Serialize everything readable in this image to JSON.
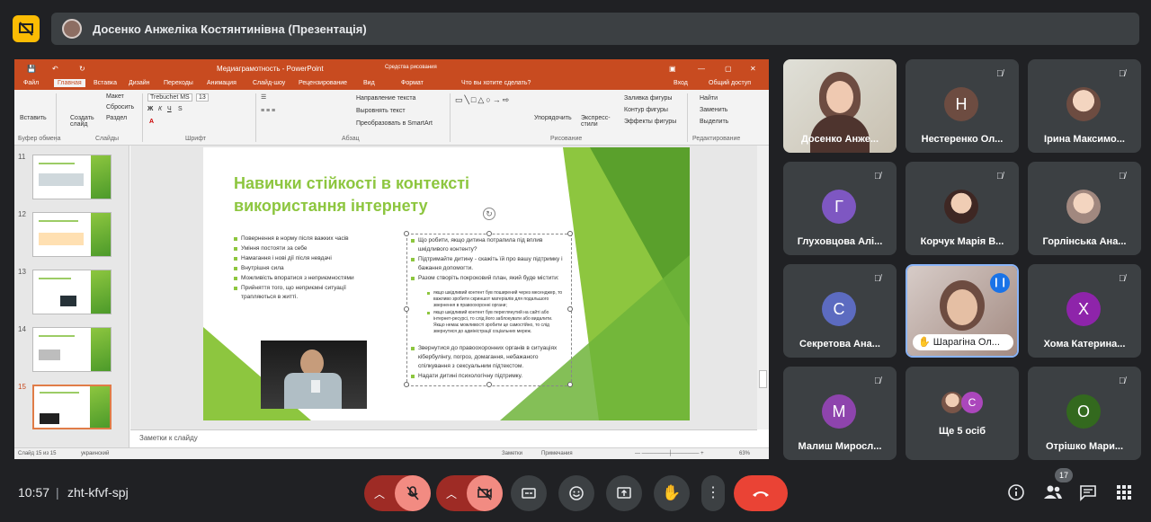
{
  "presenter": {
    "name": "Досенко Анжеліка Костянтинівна (Презентація)"
  },
  "ppt": {
    "file_title": "Медиаграмотность - PowerPoint",
    "tools": "Средства рисования",
    "tabs": [
      "Файл",
      "Главная",
      "Вставка",
      "Дизайн",
      "Переходы",
      "Анимация",
      "Слайд-шоу",
      "Рецензирование",
      "Вид",
      "Формат"
    ],
    "tell_me": "Что вы хотите сделать?",
    "signin": "Вход",
    "share": "Общий доступ",
    "ribbon": {
      "paste": "Вставить",
      "create_slide": "Создать слайд",
      "layout": "Макет",
      "reset": "Сбросить",
      "section": "Раздел",
      "font_name": "Trebuchet MS",
      "font_size": "13",
      "text_dir": "Направление текста",
      "align_text": "Выровнять текст",
      "smartart": "Преобразовать в SmartArt",
      "arrange": "Упорядочить",
      "quick_styles": "Экспресс-стили",
      "fill": "Заливка фигуры",
      "outline": "Контур фигуры",
      "effects": "Эффекты фигуры",
      "find": "Найти",
      "replace": "Заменить",
      "select": "Выделить",
      "groups": [
        "Буфер обмена",
        "Слайды",
        "Шрифт",
        "Абзац",
        "Рисование",
        "Редактирование"
      ]
    },
    "thumb_numbers": [
      "11",
      "12",
      "13",
      "14",
      "15"
    ],
    "slide": {
      "title": "Навички стійкості в контексті використання інтернету",
      "left_bullets": [
        "Повернення в норму після важких часів",
        "Уміння постояти за себе",
        "Намагання і нові дії після невдачі",
        "Внутрішня сила",
        "Можливість впоратися з неприємностями",
        "Прийняття того, що неприємні ситуації трапляються в житті."
      ],
      "right_bullets": [
        "Що робити, якщо дитина потрапила під вплив шкідливого контенту?",
        "Підтримайте дитину - скажіть їй про вашу підтримку і бажання допомогти.",
        "Разом створіть покроковий план, який буде містити:"
      ],
      "right_sub": [
        "якщо шкідливий контент був поширений через месенджер, то важливо зробити скриншот матеріалів для подальшого звернення в правоохоронні органи;",
        "якщо шкідливий контент був переглянутий на сайті або інтернет-ресурсі, то слід його заблокувати або видалити. Якщо немає можливості зробити це самостійно, то слід звернутися до адміністрації соціальних мереж."
      ],
      "right_bullets2": [
        "Звернутися до правоохоронних органів в ситуаціях кібербулінгу, погроз, домагання, небажаного спілкування з сексуальним підтекстом.",
        "Надати дитині психологічну підтримку."
      ]
    },
    "notes": "Заметки к слайду",
    "status": {
      "slide": "Слайд 15 из 15",
      "lang": "украинский",
      "notes": "Заметки",
      "comments": "Примечания",
      "zoom": "63%"
    }
  },
  "participants": [
    {
      "name": "Досенко Анже...",
      "initial": "",
      "color": "#a1887f"
    },
    {
      "name": "Нестеренко Ол...",
      "initial": "Н",
      "color": "#6d4c41"
    },
    {
      "name": "Ірина Максимо...",
      "initial": "",
      "color": "#8d6e63"
    },
    {
      "name": "Глуховцова Алі...",
      "initial": "Г",
      "color": "#7e57c2"
    },
    {
      "name": "Корчук Марія В...",
      "initial": "",
      "color": "#5d4037"
    },
    {
      "name": "Горлінська Ана...",
      "initial": "",
      "color": "#a1887f"
    },
    {
      "name": "Секретова Ана...",
      "initial": "С",
      "color": "#5c6bc0"
    },
    {
      "name": "Шарагіна Ол...",
      "initial": "",
      "color": "#8d6e63"
    },
    {
      "name": "Хома Катерина...",
      "initial": "Х",
      "color": "#8e24aa"
    },
    {
      "name": "Малиш Миросл...",
      "initial": "М",
      "color": "#8e44ad"
    },
    {
      "name": "Ще 5 осіб",
      "initial": "С",
      "color": "#ab47bc"
    },
    {
      "name": "Отрішко Мари...",
      "initial": "О",
      "color": "#33691e"
    }
  ],
  "meeting": {
    "time": "10:57",
    "separator": "|",
    "code": "zht-kfvf-spj",
    "people_count": "17"
  },
  "colors": {
    "accent": "#8dc63f",
    "end_call": "#ea4335",
    "mic_off": "#f28b82",
    "ppt_orange": "#c84b20"
  }
}
